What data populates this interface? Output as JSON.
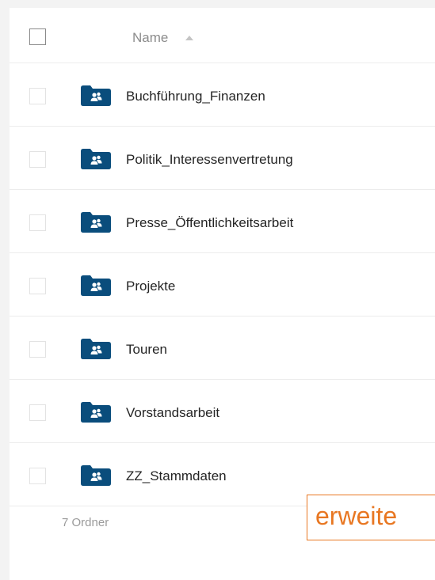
{
  "header": {
    "name_label": "Name"
  },
  "folders": [
    {
      "label": "Buchführung_Finanzen"
    },
    {
      "label": "Politik_Interessenvertretung"
    },
    {
      "label": "Presse_Öffentlichkeitsarbeit"
    },
    {
      "label": "Projekte"
    },
    {
      "label": "Touren"
    },
    {
      "label": "Vorstandsarbeit"
    },
    {
      "label": "ZZ_Stammdaten"
    }
  ],
  "footer": {
    "count_label": "7 Ordner",
    "action_label": "erweite"
  },
  "colors": {
    "folder": "#0a4d7c",
    "accent": "#e87722"
  },
  "icons": {
    "folder": "shared-folder-icon",
    "sort": "sort-ascending-icon"
  }
}
